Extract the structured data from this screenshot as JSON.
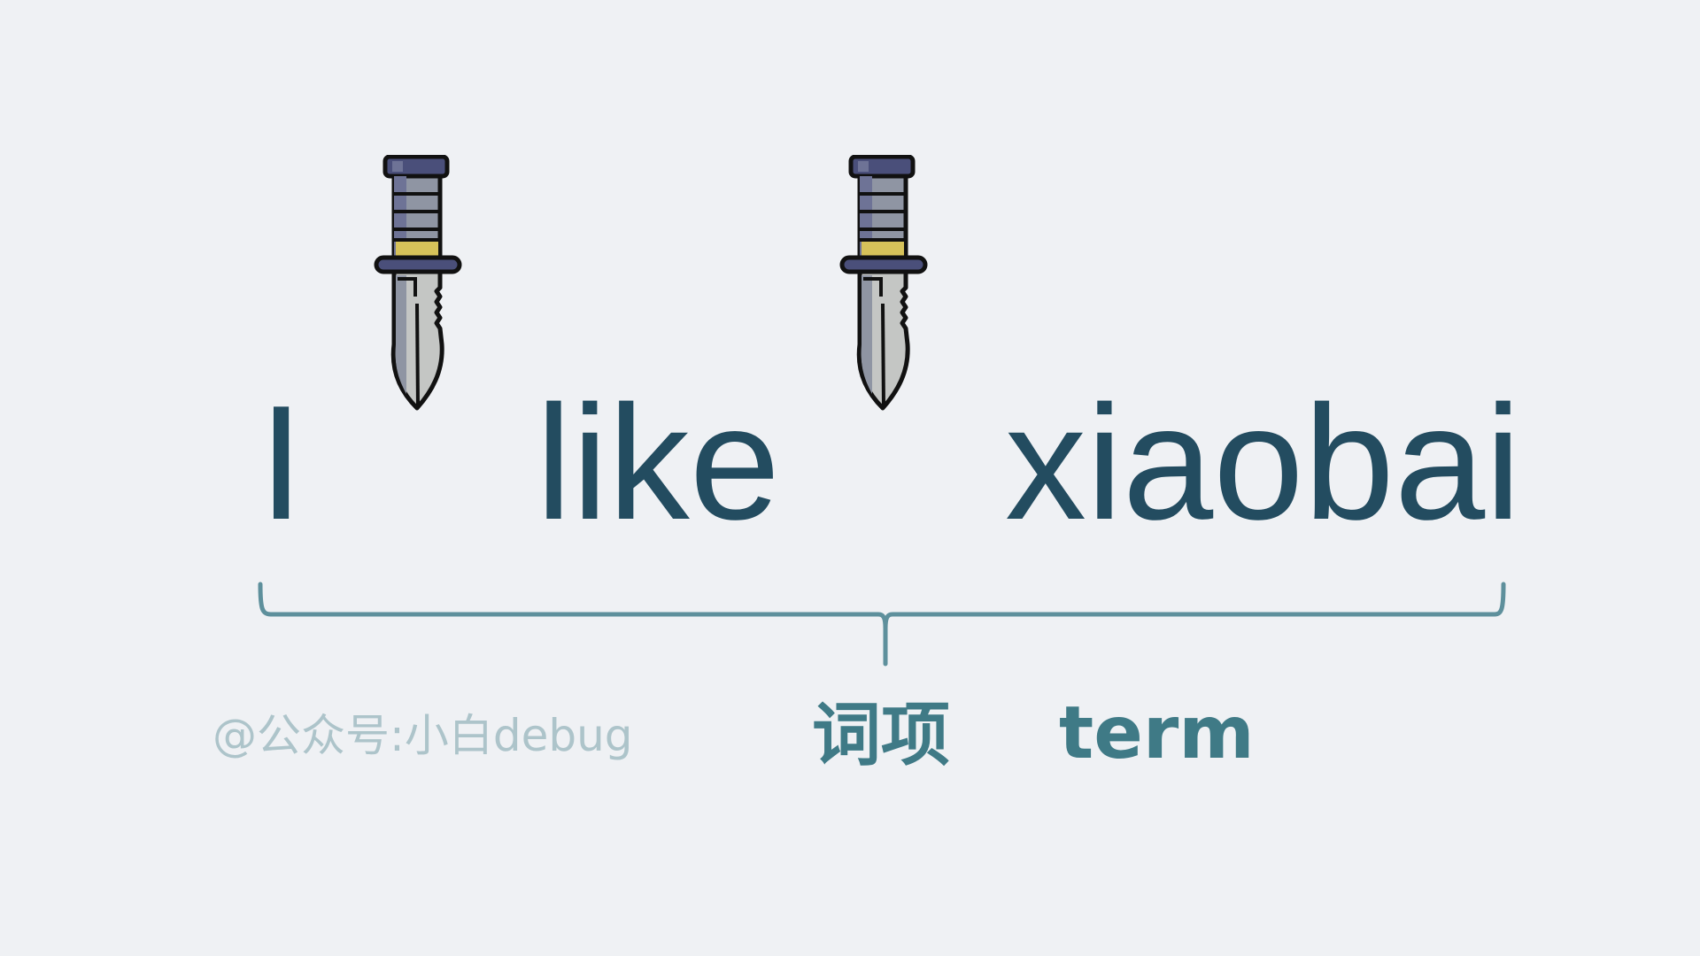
{
  "sentence": {
    "words": [
      "I",
      "like",
      "xiaobai"
    ]
  },
  "separators": [
    {
      "icon": "knife-icon"
    },
    {
      "icon": "knife-icon"
    }
  ],
  "brace": {
    "icon": "curly-brace-icon",
    "color": "#5e909c"
  },
  "labels": {
    "chinese": "词项",
    "english": "term"
  },
  "watermark": "@公众号:小白debug",
  "colors": {
    "background": "#eff1f4",
    "word": "#234c60",
    "label": "#3f7a86",
    "watermark": "#adc4ca",
    "knife_handle": "#4a4f7a",
    "knife_grip": "#8f95a3",
    "knife_band": "#d6c25a",
    "knife_blade": "#c4c6c4"
  }
}
